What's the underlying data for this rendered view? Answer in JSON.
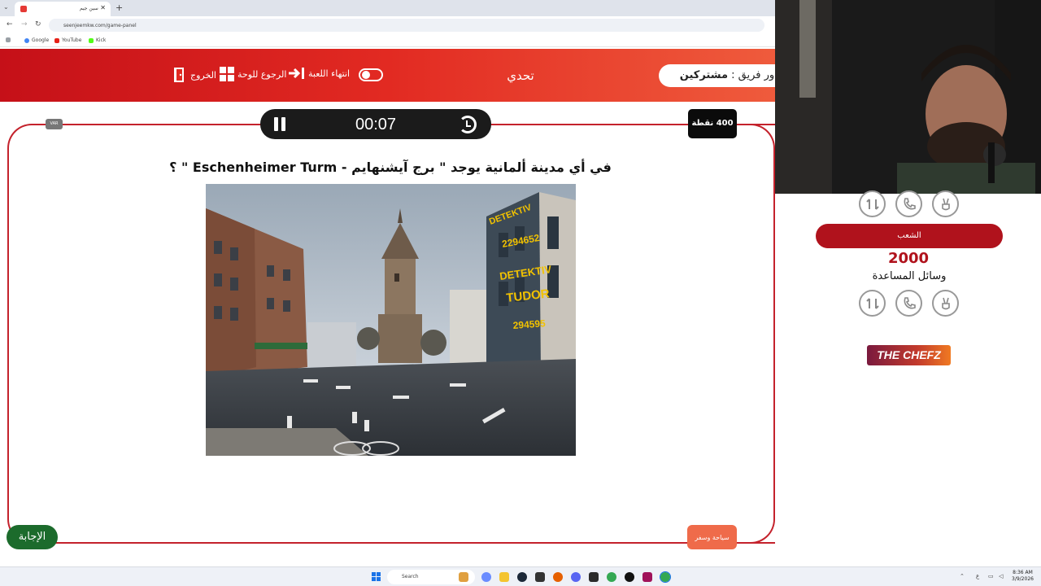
{
  "browser": {
    "tab_title": "سين جيم",
    "url": "seenjeemkw.com/game-panel",
    "bookmarks": [
      "Google",
      "YouTube",
      "Kick"
    ]
  },
  "header": {
    "team_turn_label": "دور فريق :",
    "team_turn_name": "مشتركين",
    "challenge_label": "تحدي",
    "end_game_label": "انتهاء اللعبة",
    "back_to_board_label": "الرجوع للوحة",
    "exit_label": "الخروج"
  },
  "timer": {
    "time": "00:07"
  },
  "points_badge": "400 نقطة",
  "var_badge": "VAR",
  "question": "في أي مدينة ألمانية يوجد \" برج آيشنهايم - Eschenheimer Turm \" ؟",
  "photo": {
    "sign_lines": [
      "DETEKTIV",
      "2294652",
      "DETEKTIV",
      "TUDOR",
      "294595"
    ]
  },
  "answer_button": "الإجابة",
  "category_button": "سياحة وسفر",
  "right_panel": {
    "team_name": "الشعب",
    "score": "2000",
    "aids_label": "وسائل المساعدة",
    "brand": "THE CHEFZ"
  },
  "taskbar": {
    "search_placeholder": "Search",
    "time": "8:36 AM",
    "date": "3/9/2026",
    "lang": "ع"
  },
  "colors": {
    "header_start": "#c51018",
    "header_end": "#ef5b3c",
    "panel_border": "#c4222c",
    "answer_green": "#1c6b2c",
    "category_orange": "#ef6b4a",
    "team_red": "#b0121c"
  }
}
